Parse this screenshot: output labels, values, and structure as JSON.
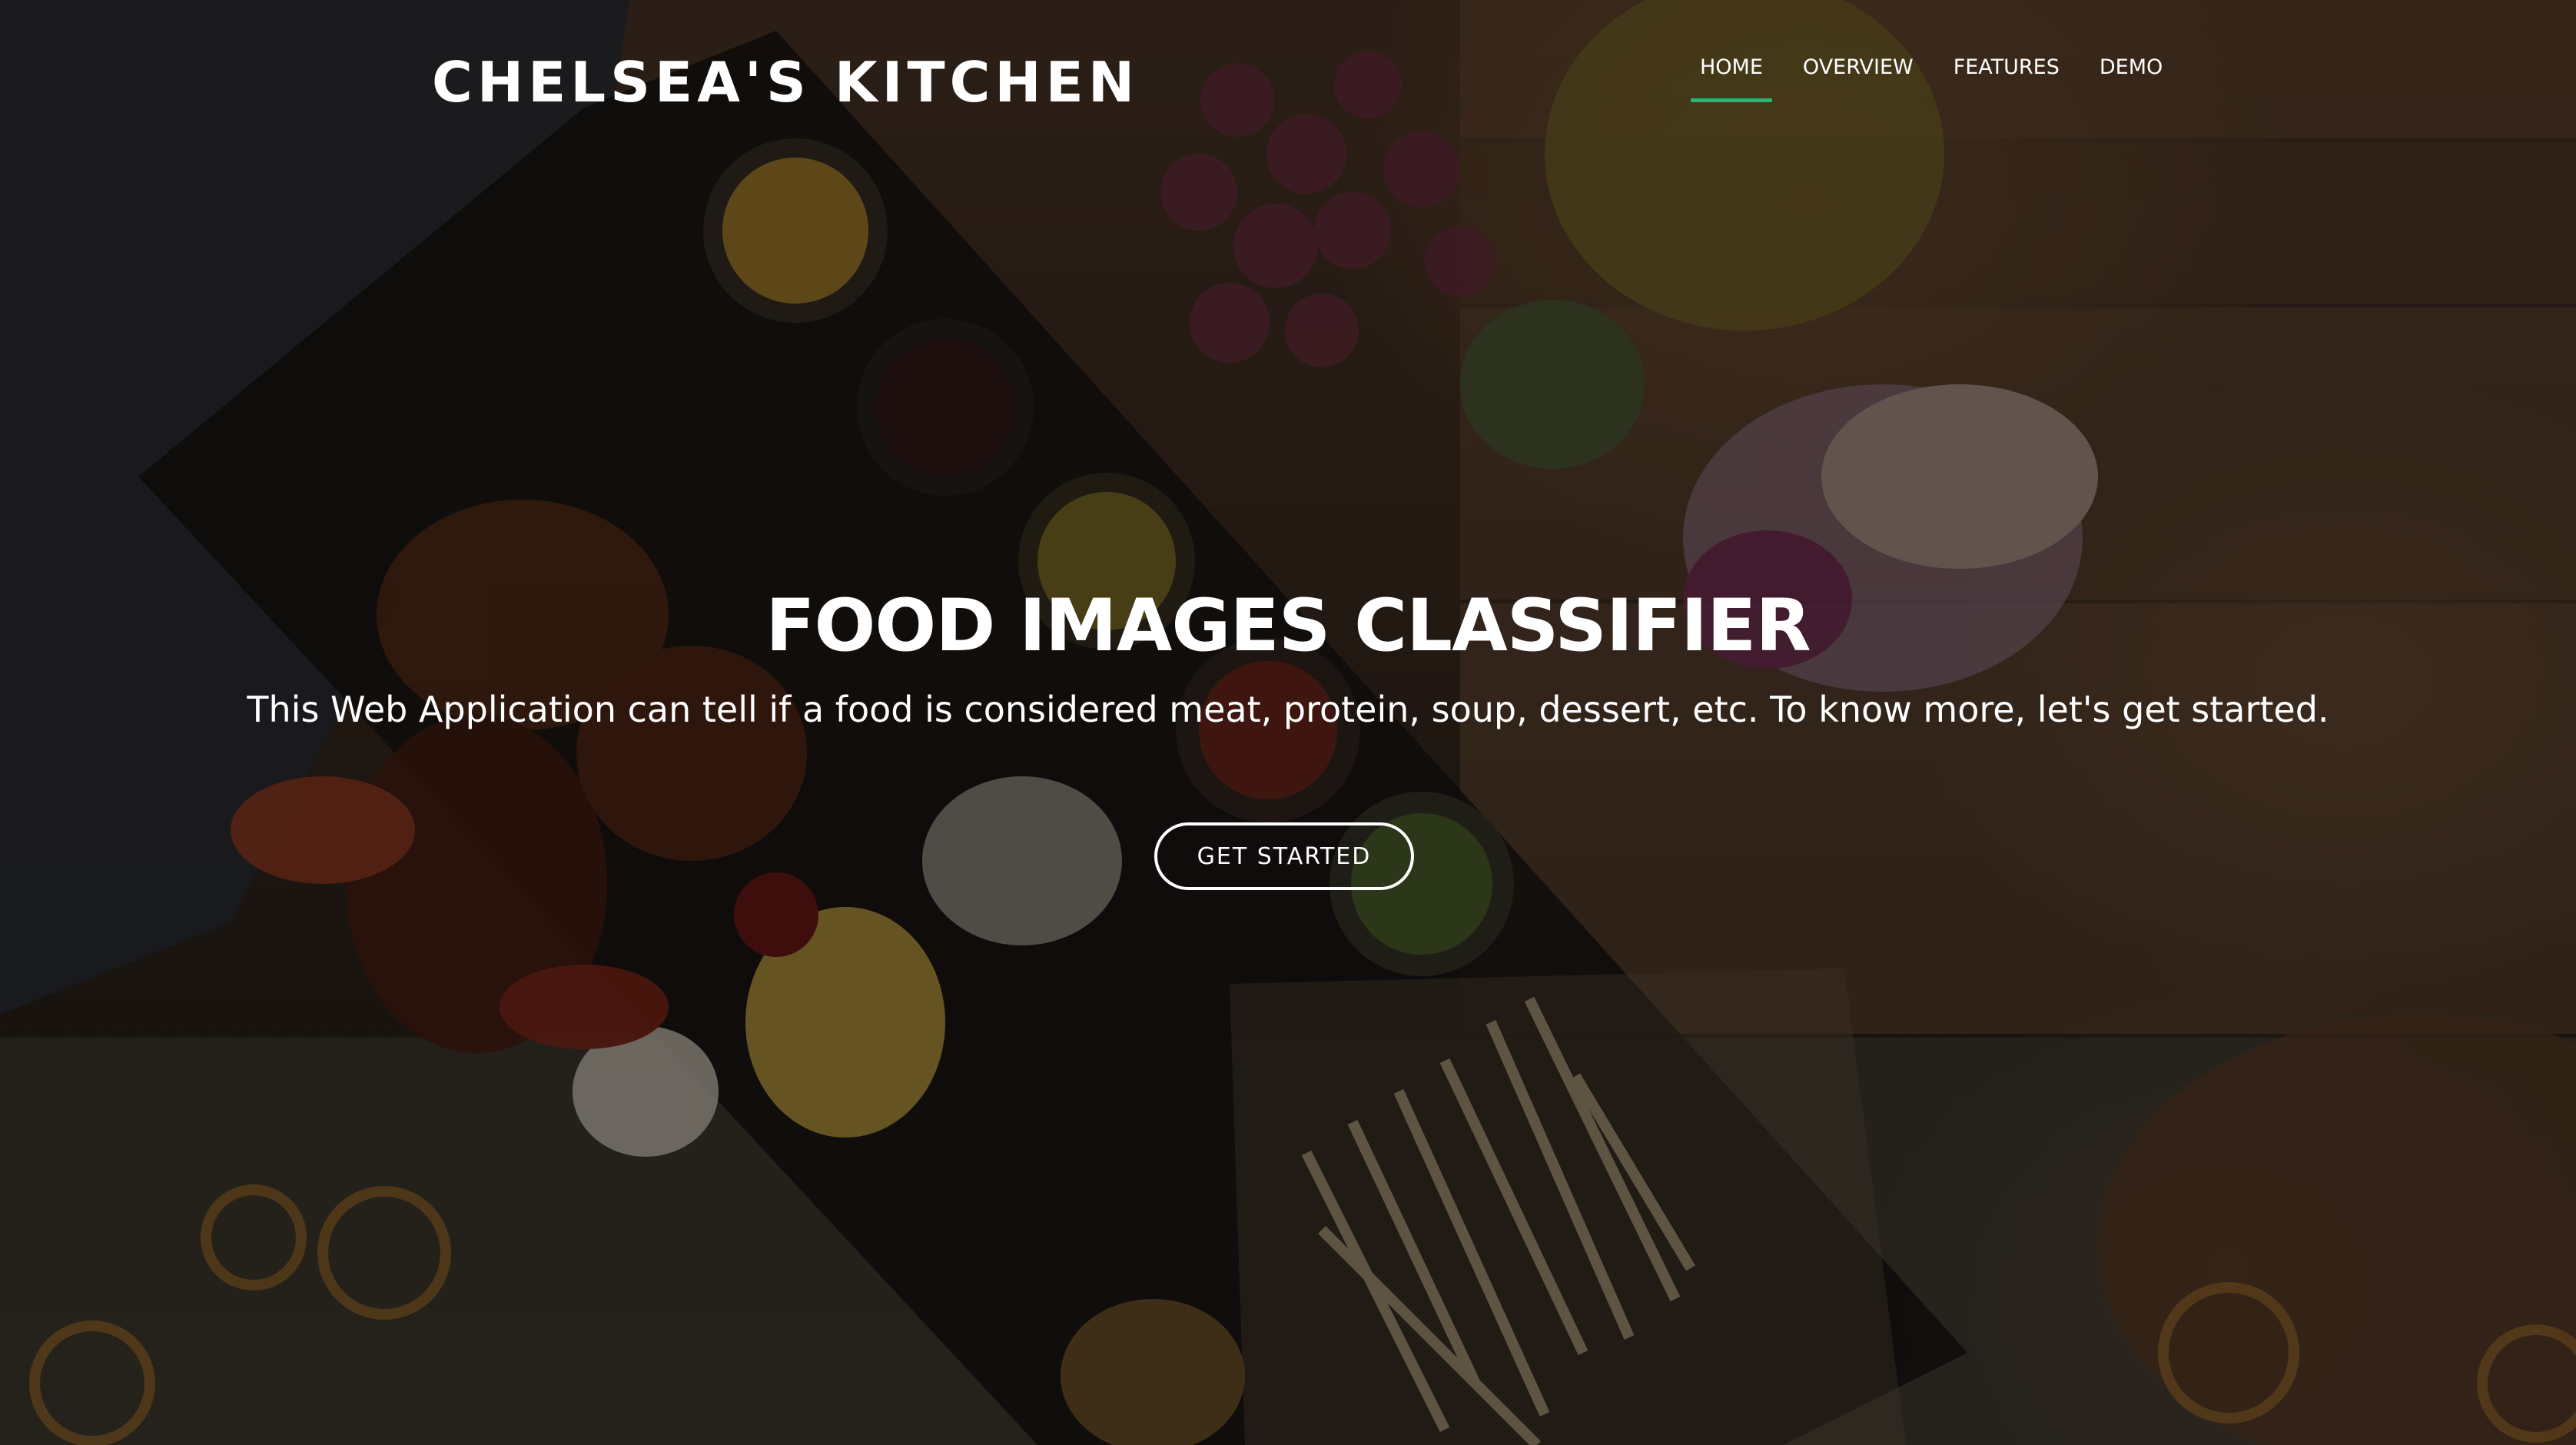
{
  "header": {
    "brand": "CHELSEA'S KITCHEN",
    "nav": [
      {
        "label": "HOME",
        "active": true
      },
      {
        "label": "OVERVIEW",
        "active": false
      },
      {
        "label": "FEATURES",
        "active": false
      },
      {
        "label": "DEMO",
        "active": false
      }
    ]
  },
  "hero": {
    "title": "FOOD IMAGES CLASSIFIER",
    "subtitle": "This Web Application can tell if a food is considered meat, protein, soup, dessert, etc. To know more, let's get started.",
    "cta_label": "GET STARTED",
    "background_image": "food-table-photo"
  },
  "colors": {
    "accent": "#2bb673",
    "text": "#ffffff",
    "overlay": "rgba(0,0,0,0.42)"
  }
}
